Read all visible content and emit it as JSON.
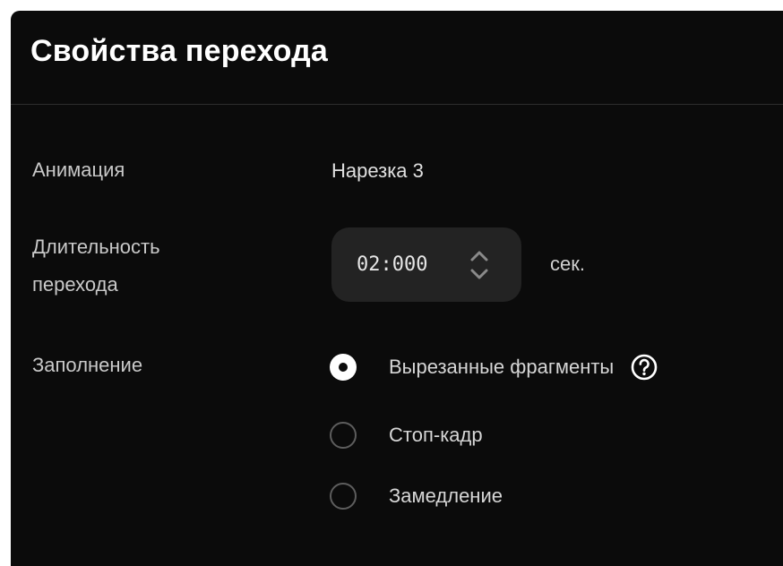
{
  "panel": {
    "title": "Свойства перехода"
  },
  "animation": {
    "label": "Анимация",
    "value": "Нарезка 3"
  },
  "duration": {
    "label_line1": "Длительность",
    "label_line2": "перехода",
    "value": "02:000",
    "unit": "сек.",
    "arrows_icon": "chevron-up-down-icon"
  },
  "fill": {
    "label": "Заполнение",
    "options": [
      {
        "label": "Вырезанные фрагменты",
        "selected": true,
        "help_icon": "question-circle-icon"
      },
      {
        "label": "Стоп-кадр",
        "selected": false
      },
      {
        "label": "Замедление",
        "selected": false
      }
    ]
  },
  "colors": {
    "panel_background": "#0b0b0b",
    "stepper_background": "#232323",
    "radio_selected": "#ffffff",
    "radio_border": "#5d5d5d"
  }
}
